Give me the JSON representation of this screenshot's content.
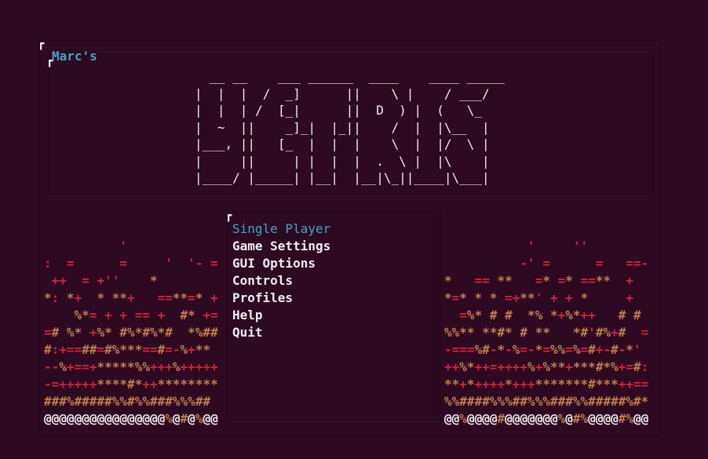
{
  "window": {
    "title": "Marc's"
  },
  "logo_art": [
    "  __ __    ___ ______  ____    ____ _____",
    "|  |  |  /  _]      ||    \\ |    / ___/",
    "|  |  | /  [_|      ||  D  ) |  (   \\_",
    "|  ~  ||    _]_|  |_||    /  |  |\\__  |",
    "|___, ||   [_  |  |  |    \\  |  |/  \\ |",
    "|     ||     | |  |  |  .  \\ |  |\\    |",
    "|____/ |_____| |__|  |__|\\_||____|\\___|"
  ],
  "menu": {
    "items": [
      "Single Player",
      "Game Settings",
      "GUI Options",
      "Controls",
      "Profiles",
      "Help",
      "Quit"
    ],
    "selected_index": 0
  },
  "fire_left": [
    "          '",
    ":  =      =     '  '- =",
    " ++  = +''    *",
    "*: *+  * **+   ==**=* +",
    "    %*= + + == +  #* +=",
    "=# %* +%* #%*#%*#  *%##",
    "#:+==##=#%***==#=-%+**",
    "--%+==+*****%%+++%+++++",
    "-=+++++****#*++********",
    "###%#####%%#%%###%%%##",
    "@@@@@@@@@@@@@@@@%@#@%@@"
  ],
  "fire_right": [
    "           '     ''",
    "          -' =      =   ==-",
    "*   == **   =* =* ==**  +",
    "*=* * * =+**' + + *     +",
    "  =%* # #  *% *+%*++   # #",
    "%%** **#* # **   *#'#%+#  =",
    "-===%#-*-%=-*=%%=%=#+-#-*'",
    "++%*++=++++%+%**+***#*%+=#:",
    "**+*++++*+++*******#***++==",
    "%%####%%%##%%%###%%#####%#*",
    "@@%@@@@#@@@@@@@%@#%@@@@#%@@"
  ],
  "colors": {
    "background": "#2d0922",
    "accent": "#3fa6bf",
    "fire_red": "#d1233a",
    "fire_orange": "#c27e4e",
    "text": "#eeeeee"
  }
}
